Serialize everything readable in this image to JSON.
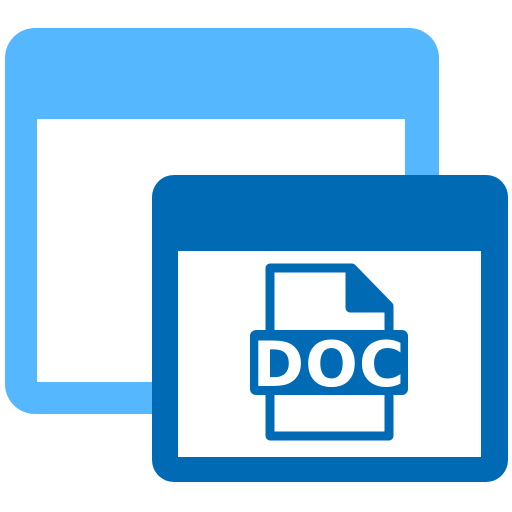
{
  "icon": {
    "name": "doc-window-icon",
    "badge_text": "DOC"
  },
  "colors": {
    "back_window": "#55b8ff",
    "front_window": "#006ab5",
    "window_content": "#ffffff",
    "badge_text": "#ffffff"
  }
}
